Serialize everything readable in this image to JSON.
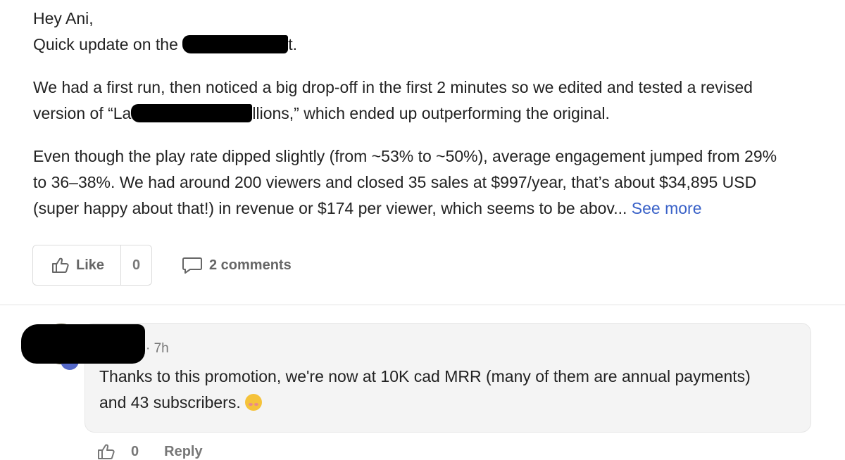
{
  "post": {
    "greeting": "Hey Ani,",
    "line2_prefix": "Quick update on the ",
    "line2_suffix": "t.",
    "para1_line1": "We had a first run, then noticed a big drop-off in the first 2 minutes so we edited and tested a revised",
    "para1_line2_prefix": "version of “La",
    "para1_line2_suffix": "llions,” which ended up outperforming the original.",
    "para2_line1": "Even though the play rate dipped slightly (from ~53% to ~50%), average engagement jumped from 29%",
    "para2_line2": "to 36–38%. We had around 200 viewers and closed 35 sales at $997/year, that’s about $34,895 USD",
    "para2_line3": "(super happy about that!) in revenue or $174 per viewer, which seems to be abov...",
    "see_more": " See more"
  },
  "actions": {
    "like_label": "Like",
    "like_count": "0",
    "comments_label": "2 comments"
  },
  "comment": {
    "time": "· 7h",
    "text_line1": "Thanks to this promotion, we're now at 10K cad MRR (many of them are annual payments)",
    "text_line2": "and 43 subscribers.",
    "emoji": "face-with-hand-over-mouth-emoji",
    "like_count": "0",
    "reply_label": "Reply"
  },
  "colors": {
    "link": "#3a62c8",
    "muted": "#777777",
    "bubble": "#f4f4f4"
  }
}
